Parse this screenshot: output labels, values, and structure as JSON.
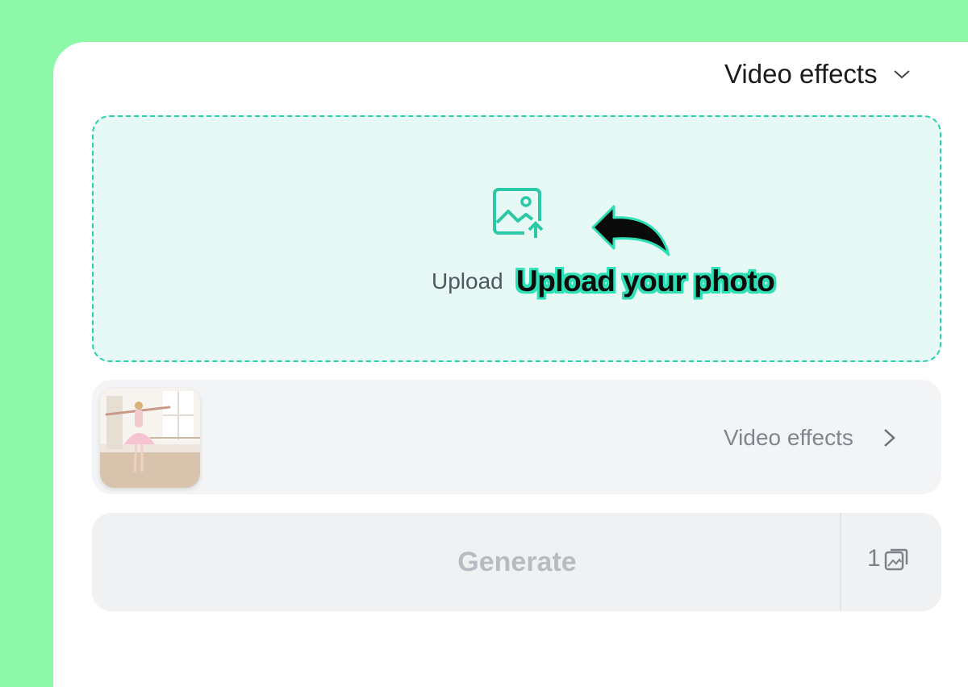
{
  "header": {
    "dropdown_label": "Video effects"
  },
  "upload": {
    "label": "Upload",
    "icon": "image-upload-icon",
    "callout": "Upload your photo"
  },
  "effects_row": {
    "label": "Video effects",
    "thumbnail": "ballerina-photo"
  },
  "generate": {
    "label": "Generate",
    "count": "1",
    "count_icon": "images-icon"
  },
  "colors": {
    "accent": "#2bd1ad",
    "page_bg": "#8cf8a8",
    "upload_bg": "#e6f9f4"
  }
}
